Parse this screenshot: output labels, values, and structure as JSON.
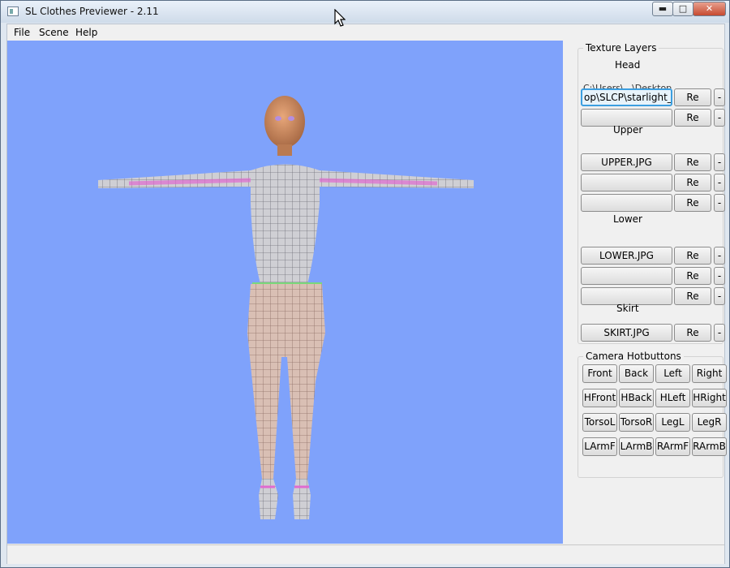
{
  "window": {
    "title": "SL Clothes Previewer - 2.11"
  },
  "menu": [
    "File",
    "Scene",
    "Help"
  ],
  "panel": {
    "texture_title": "Texture Layers",
    "head": {
      "label": "Head",
      "cut_path_text": "C:\\Users\\...\\Desktop",
      "rows": [
        {
          "file": "op\\SLCP\\starlight_fa",
          "reload": "Re",
          "remove": "-"
        },
        {
          "file": "",
          "reload": "Re",
          "remove": "-"
        }
      ]
    },
    "upper": {
      "label": "Upper",
      "rows": [
        {
          "file": "UPPER.JPG",
          "reload": "Re",
          "remove": "-"
        },
        {
          "file": "",
          "reload": "Re",
          "remove": "-"
        },
        {
          "file": "",
          "reload": "Re",
          "remove": "-"
        }
      ]
    },
    "lower": {
      "label": "Lower",
      "rows": [
        {
          "file": "LOWER.JPG",
          "reload": "Re",
          "remove": "-"
        },
        {
          "file": "",
          "reload": "Re",
          "remove": "-"
        },
        {
          "file": "",
          "reload": "Re",
          "remove": "-"
        }
      ]
    },
    "skirt": {
      "label": "Skirt",
      "rows": [
        {
          "file": "SKIRT.JPG",
          "reload": "Re",
          "remove": "-"
        }
      ]
    },
    "camera_title": "Camera Hotbuttons",
    "camera_buttons": [
      [
        "Front",
        "Back",
        "Left",
        "Right"
      ],
      [
        "HFront",
        "HBack",
        "HLeft",
        "HRight"
      ],
      [
        "TorsoL",
        "TorsoR",
        "LegL",
        "LegR"
      ],
      [
        "LArmF",
        "LArmB",
        "RArmF",
        "RArmB"
      ]
    ]
  },
  "colors": {
    "viewport_bg": "#7fa2fb",
    "mesh_base": "#cfcfd4",
    "skin": "#c9875e"
  },
  "icons": [
    "window-app-icon",
    "minimize-icon",
    "maximize-icon",
    "close-icon",
    "mouse-cursor-icon"
  ]
}
